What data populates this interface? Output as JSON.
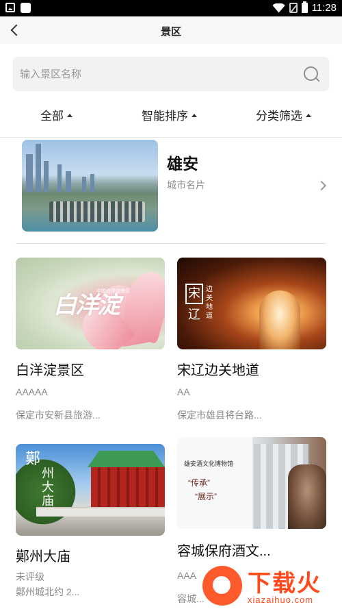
{
  "status_bar": {
    "time": "11:28"
  },
  "header": {
    "title": "景区"
  },
  "search": {
    "placeholder": "输入景区名称"
  },
  "filters": [
    {
      "label": "全部"
    },
    {
      "label": "智能排序"
    },
    {
      "label": "分类筛选"
    }
  ],
  "featured": {
    "name": "雄安",
    "subtitle": "城市名片"
  },
  "cards": [
    {
      "name": "白洋淀景区",
      "grade": "AAAAA",
      "address": "保定市安新县旅游...",
      "image_text": "白洋淀",
      "image_small": "中国白洋淀景区"
    },
    {
      "name": "宋辽边关地道",
      "grade": "AA",
      "address": "保定市雄县将台路...",
      "image_seal_1": "宋",
      "image_seal_2": "辽",
      "image_vertical": "边关地道"
    },
    {
      "name": "鄚州大庙",
      "grade": "未评级",
      "address": "鄚州城北约 2...",
      "image_text_1": "鄚",
      "image_text_2": "州大庙"
    },
    {
      "name": "容城保府酒文...",
      "grade": "AAA",
      "address": "容城...",
      "image_title": "雄安酒文化博物馆",
      "image_line1": "“传承”",
      "image_line2": "“展示”"
    }
  ],
  "watermark": {
    "brand": "下载火",
    "url": "xiazaihuo.com"
  },
  "colors": {
    "watermark": "#ff4a1c",
    "search_bg": "#f2f2f2",
    "muted_text": "#8a8a8a"
  }
}
